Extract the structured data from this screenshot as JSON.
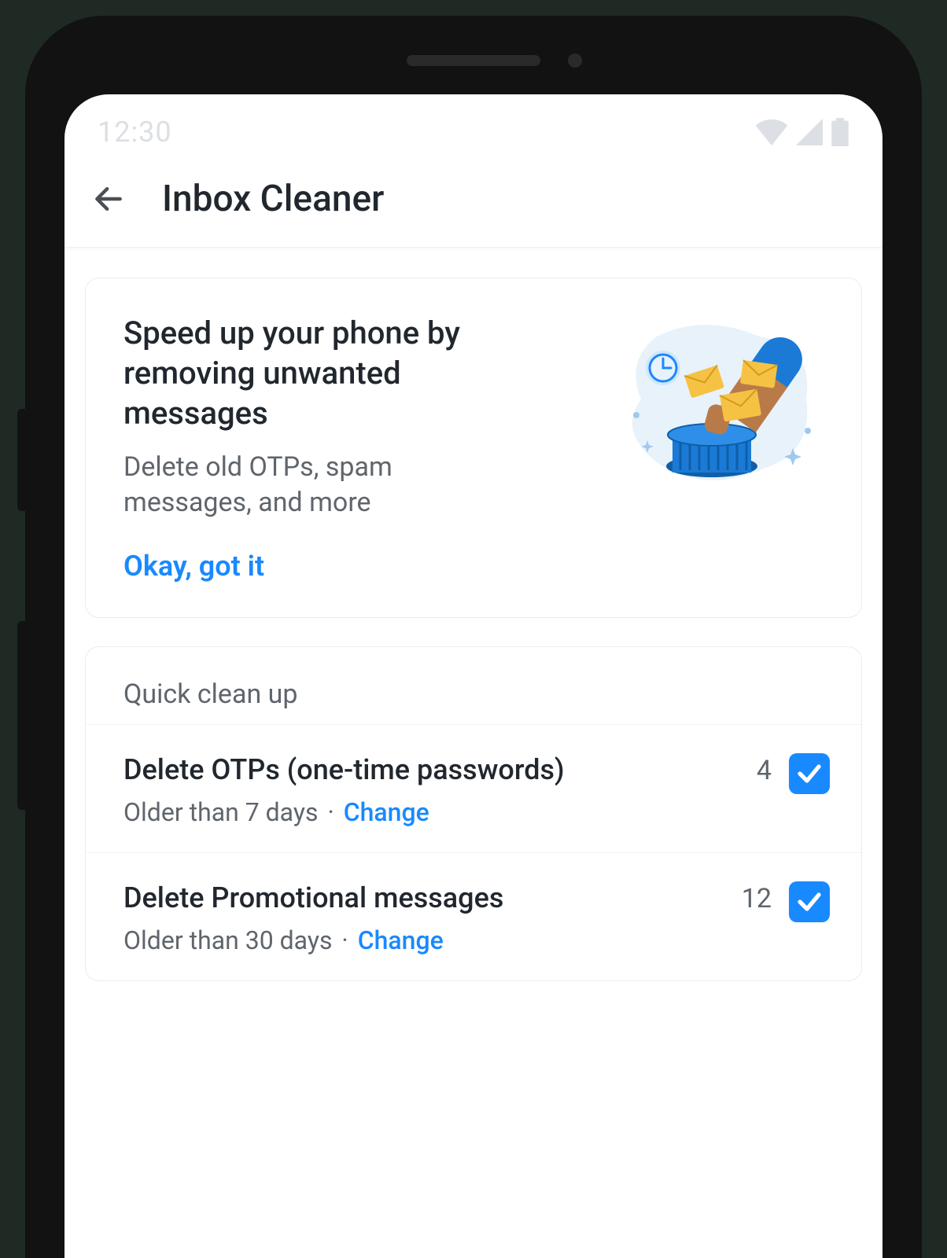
{
  "status": {
    "time": "12:30"
  },
  "header": {
    "title": "Inbox Cleaner"
  },
  "promo": {
    "title": "Speed up your phone by removing unwanted messages",
    "subtitle": "Delete old OTPs, spam messages, and more",
    "cta": "Okay, got it"
  },
  "cleanup": {
    "section_title": "Quick clean up",
    "items": [
      {
        "title": "Delete OTPs (one-time passwords)",
        "age": "Older than 7 days",
        "change": "Change",
        "count": "4",
        "checked": true
      },
      {
        "title": "Delete Promotional messages",
        "age": "Older than 30 days",
        "change": "Change",
        "count": "12",
        "checked": true
      }
    ]
  }
}
